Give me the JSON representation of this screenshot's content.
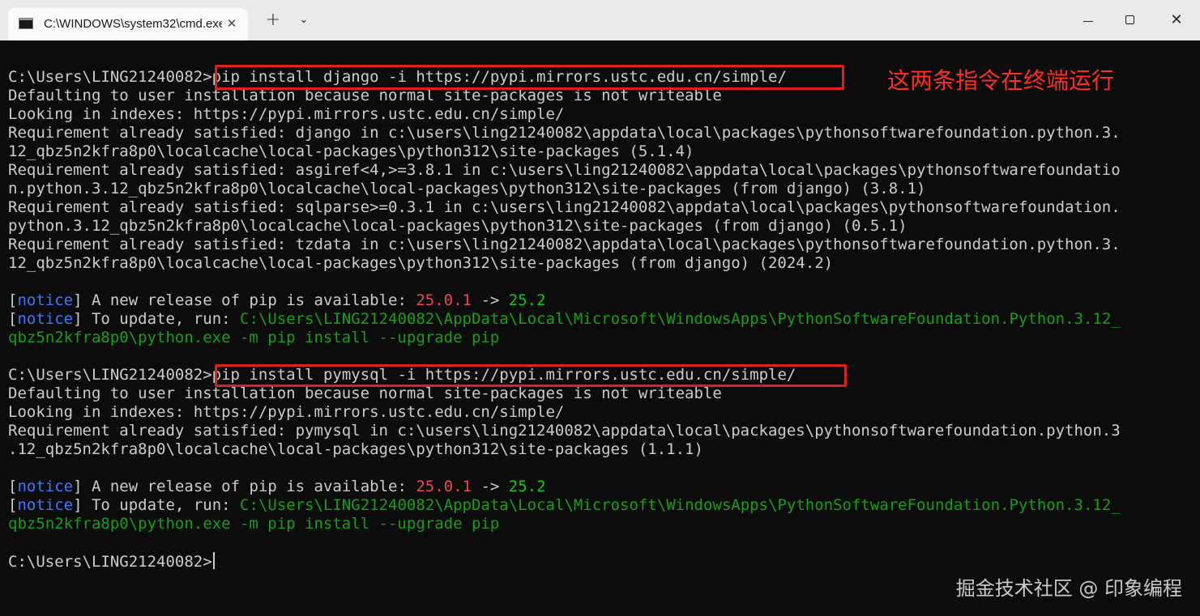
{
  "window": {
    "tab_title": "C:\\WINDOWS\\system32\\cmd.exe",
    "tab_close_glyph": "✕",
    "new_tab_glyph": "+",
    "dropdown_glyph": "⌄",
    "close_glyph": "✕"
  },
  "annotation": "这两条指令在终端运行",
  "watermark": "掘金技术社区 @ 印象编程",
  "colors": {
    "background": "#0c0c0c",
    "text": "#cccccc",
    "notice": "#3b78ff",
    "old_version": "#e74856",
    "new_version": "#16c60c",
    "path": "#13a10e",
    "highlight": "#e0201c",
    "annotation": "#ff2d1f"
  },
  "terminal": {
    "prompt": "C:\\Users\\LING21240082>",
    "block1": {
      "command": "pip install django -i https://pypi.mirrors.ustc.edu.cn/simple/",
      "output": [
        "Defaulting to user installation because normal site-packages is not writeable",
        "Looking in indexes: https://pypi.mirrors.ustc.edu.cn/simple/",
        "Requirement already satisfied: django in c:\\users\\ling21240082\\appdata\\local\\packages\\pythonsoftwarefoundation.python.3.",
        "12_qbz5n2kfra8p0\\localcache\\local-packages\\python312\\site-packages (5.1.4)",
        "Requirement already satisfied: asgiref<4,>=3.8.1 in c:\\users\\ling21240082\\appdata\\local\\packages\\pythonsoftwarefoundatio",
        "n.python.3.12_qbz5n2kfra8p0\\localcache\\local-packages\\python312\\site-packages (from django) (3.8.1)",
        "Requirement already satisfied: sqlparse>=0.3.1 in c:\\users\\ling21240082\\appdata\\local\\packages\\pythonsoftwarefoundation.",
        "python.3.12_qbz5n2kfra8p0\\localcache\\local-packages\\python312\\site-packages (from django) (0.5.1)",
        "Requirement already satisfied: tzdata in c:\\users\\ling21240082\\appdata\\local\\packages\\pythonsoftwarefoundation.python.3.",
        "12_qbz5n2kfra8p0\\localcache\\local-packages\\python312\\site-packages (from django) (2024.2)"
      ],
      "notice1": {
        "open": "[",
        "tag": "notice",
        "close": "]",
        "text": " A new release of pip is available: ",
        "old": "25.0.1",
        "arrow": " -> ",
        "new": "25.2"
      },
      "notice2": {
        "open": "[",
        "tag": "notice",
        "close": "]",
        "text": " To update, run: ",
        "cmd_line1": "C:\\Users\\LING21240082\\AppData\\Local\\Microsoft\\WindowsApps\\PythonSoftwareFoundation.Python.3.12_",
        "cmd_line2": "qbz5n2kfra8p0\\python.exe -m pip install --upgrade pip"
      }
    },
    "block2": {
      "command": "pip install pymysql -i https://pypi.mirrors.ustc.edu.cn/simple/",
      "output": [
        "Defaulting to user installation because normal site-packages is not writeable",
        "Looking in indexes: https://pypi.mirrors.ustc.edu.cn/simple/",
        "Requirement already satisfied: pymysql in c:\\users\\ling21240082\\appdata\\local\\packages\\pythonsoftwarefoundation.python.3",
        ".12_qbz5n2kfra8p0\\localcache\\local-packages\\python312\\site-packages (1.1.1)"
      ],
      "notice1": {
        "open": "[",
        "tag": "notice",
        "close": "]",
        "text": " A new release of pip is available: ",
        "old": "25.0.1",
        "arrow": " -> ",
        "new": "25.2"
      },
      "notice2": {
        "open": "[",
        "tag": "notice",
        "close": "]",
        "text": " To update, run: ",
        "cmd_line1": "C:\\Users\\LING21240082\\AppData\\Local\\Microsoft\\WindowsApps\\PythonSoftwareFoundation.Python.3.12_",
        "cmd_line2": "qbz5n2kfra8p0\\python.exe -m pip install --upgrade pip"
      }
    }
  }
}
